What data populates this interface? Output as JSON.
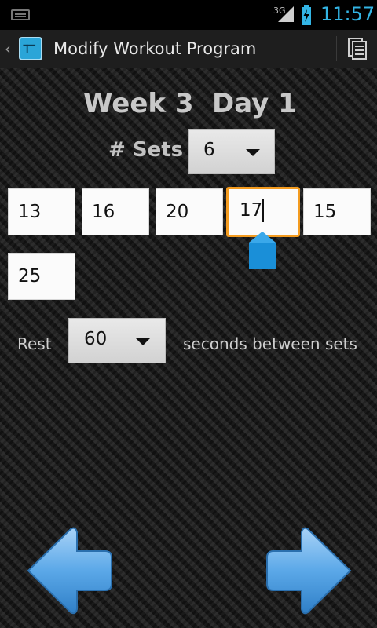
{
  "status_bar": {
    "network_type": "3G",
    "time": "11:57",
    "accent_color": "#33b5e5"
  },
  "action_bar": {
    "up_caret": "‹",
    "title": "Modify Workout Program",
    "overflow_icon": "document-icon"
  },
  "header": {
    "week": "Week 3",
    "day": "Day 1"
  },
  "sets": {
    "label": "# Sets",
    "value": "6"
  },
  "reps": {
    "values": [
      "13",
      "16",
      "20",
      "17",
      "15",
      "25"
    ],
    "focused_index": 3
  },
  "rest": {
    "label": "Rest",
    "value": "60",
    "suffix": "seconds between sets"
  },
  "navigation": {
    "prev_icon": "left-arrow-icon",
    "next_icon": "right-arrow-icon",
    "arrow_color": "#5ba8e8"
  },
  "colors": {
    "focus": "#f39b1f",
    "handle": "#1a8fd8"
  }
}
